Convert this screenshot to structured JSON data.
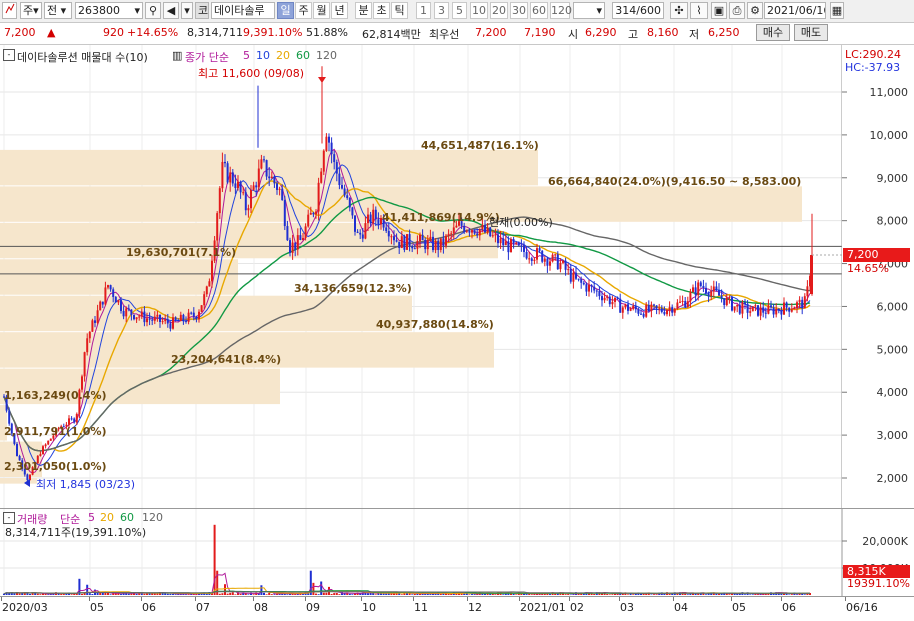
{
  "toolbar": {
    "market": "주",
    "prev_label": "전",
    "code": "263800",
    "tab_code": "코",
    "stock_name": "데이타솔루",
    "period_tabs": [
      "일",
      "주",
      "월",
      "년",
      "분",
      "초",
      "틱"
    ],
    "minute_tabs": [
      "1",
      "3",
      "5",
      "10",
      "20",
      "30",
      "60",
      "120"
    ],
    "count": "314",
    "count_max": "/600",
    "date": "2021/06/16"
  },
  "info": {
    "price": "7,200",
    "change": "920",
    "change_pct": "+14.65%",
    "volume": "8,314,711",
    "vol_ratio": "9,391.10%",
    "ratio2": "51.88%",
    "amount": "62,814백만",
    "best_label": "최우선",
    "ask": "7,200",
    "bid": "7,190",
    "open_label": "시",
    "open": "6,290",
    "high_label": "고",
    "high": "8,160",
    "low_label": "저",
    "low": "6,250",
    "buy_label": "매수",
    "sell_label": "매도"
  },
  "price_panel": {
    "title": "데이타솔루션 매물대 수(10)",
    "ma_title": "종가 단순",
    "ma_periods": [
      "5",
      "10",
      "20",
      "60",
      "120"
    ],
    "lc": "LC:290.24",
    "hc": "HC:-37.93",
    "max_label": "최고 11,600 (09/08)",
    "min_label": "최저 1,845 (03/23)",
    "current_price": "7,200",
    "current_pct": "14.65%",
    "y_ticks": [
      "11,000",
      "10,000",
      "9,000",
      "8,000",
      "7,000",
      "6,000",
      "5,000",
      "4,000",
      "3,000",
      "2,000"
    ],
    "volume_profile": [
      "2,301,050(1.0%)",
      "2,911,791(1.0%)",
      "1,163,249(0.4%)",
      "23,204,641(8.4%)",
      "40,937,880(14.8%)",
      "34,136,659(12.3%)",
      "19,630,701(7.1%)",
      "41,411,869(14.9%)",
      "66,664,840(24.0%)(9,416.50 ~ 8,583.00)",
      "44,651,487(16.1%)"
    ],
    "overlap_note": "현재(0.00%)"
  },
  "volume_panel": {
    "title": "거래량",
    "ma_title": "단순",
    "ma_periods": [
      "5",
      "20",
      "60",
      "120"
    ],
    "value_line": "8,314,711주(19,391.10%)",
    "y_ticks": [
      "20,000K",
      "10,000K"
    ],
    "cur_vol": "8,315K",
    "cur_pct": "19391.10%"
  },
  "x_axis": [
    "2020/03",
    "05",
    "06",
    "07",
    "08",
    "09",
    "10",
    "11",
    "12",
    "2021/01",
    "02",
    "03",
    "04",
    "05",
    "06",
    "06/16"
  ],
  "colors": {
    "up": "#e21b1b",
    "down": "#1f2fd1",
    "ma5": "#b01a9a",
    "ma10": "#2244dd",
    "ma20": "#e8a800",
    "ma60": "#119944",
    "ma120": "#666666",
    "profile": "#f6e6cc"
  }
}
